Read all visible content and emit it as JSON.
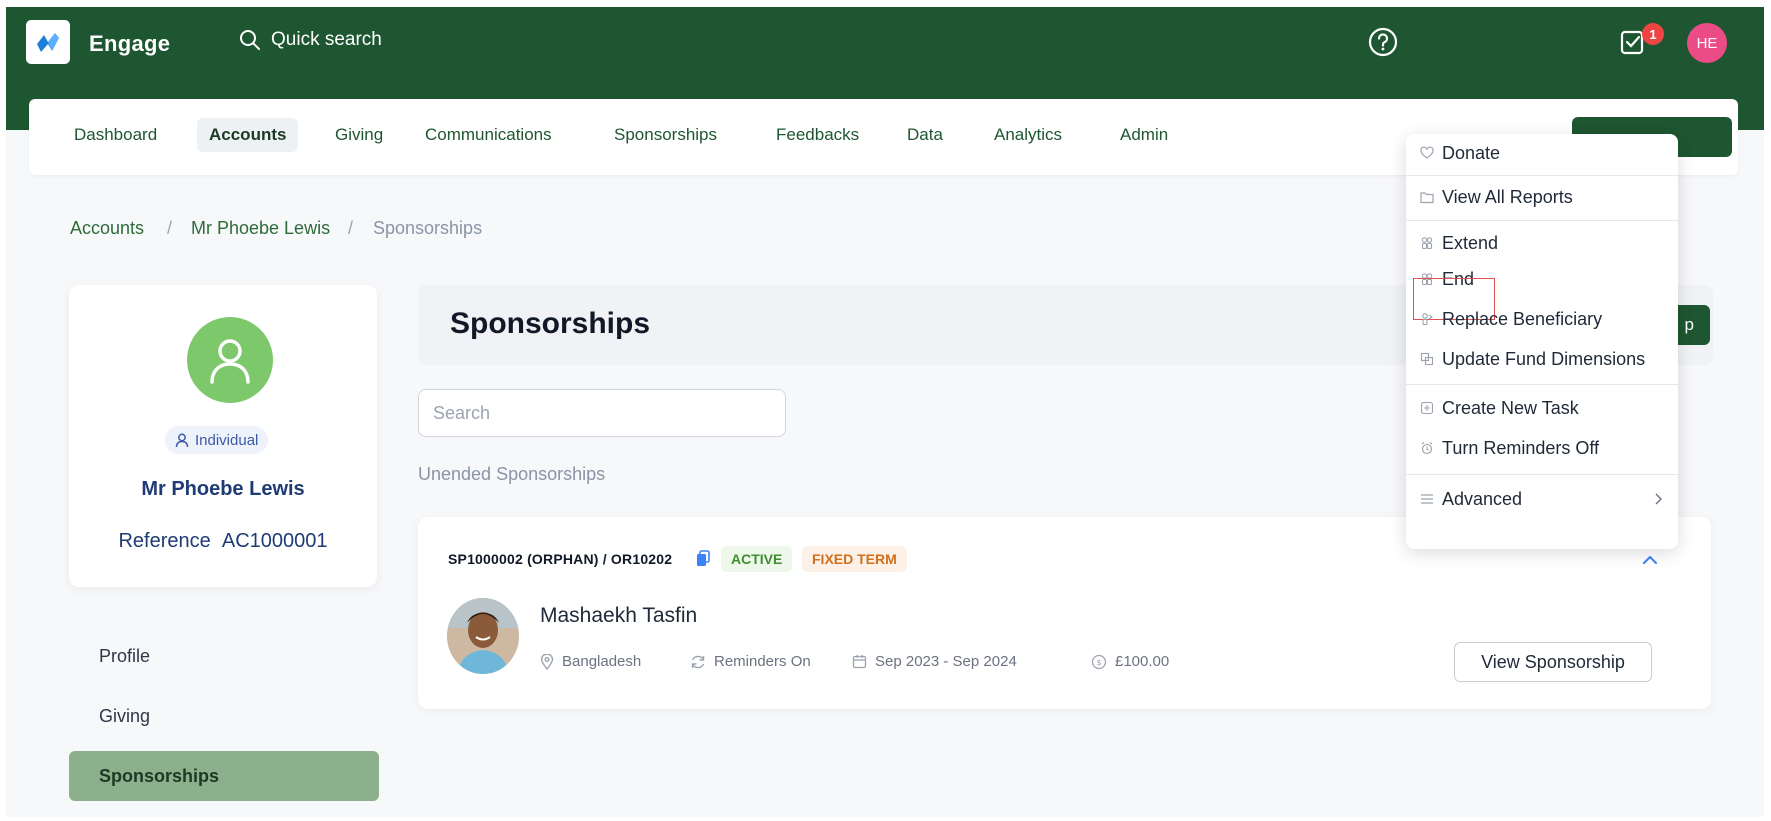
{
  "app": {
    "name": "Engage",
    "quick_search": "Quick search",
    "notification_count": "1",
    "user_initials": "HE"
  },
  "nav": {
    "items": [
      {
        "label": "Dashboard",
        "active": false
      },
      {
        "label": "Accounts",
        "active": true
      },
      {
        "label": "Giving",
        "active": false
      },
      {
        "label": "Communications",
        "active": false
      },
      {
        "label": "Sponsorships",
        "active": false
      },
      {
        "label": "Feedbacks",
        "active": false
      },
      {
        "label": "Data",
        "active": false
      },
      {
        "label": "Analytics",
        "active": false
      },
      {
        "label": "Admin",
        "active": false
      }
    ]
  },
  "breadcrumb": [
    "Accounts",
    "Mr Phoebe Lewis",
    "Sponsorships"
  ],
  "profile": {
    "type": "Individual",
    "name": "Mr Phoebe Lewis",
    "reference_label": "Reference",
    "reference": "AC1000001"
  },
  "sidebar": {
    "items": [
      {
        "label": "Profile",
        "active": false
      },
      {
        "label": "Giving",
        "active": false
      },
      {
        "label": "Sponsorships",
        "active": true
      }
    ]
  },
  "main": {
    "title": "Sponsorships",
    "search_placeholder": "Search",
    "section_label": "Unended Sponsorships",
    "partial_button_text": "p",
    "sponsorship": {
      "code": "SP1000002 (ORPHAN) / OR10202",
      "status": "ACTIVE",
      "term": "FIXED TERM",
      "beneficiary": "Mashaekh Tasfin",
      "country": "Bangladesh",
      "reminders": "Reminders On",
      "period": "Sep 2023 - Sep 2024",
      "amount": "£100.00",
      "view_button": "View Sponsorship"
    }
  },
  "menu": {
    "items": [
      {
        "label": "Donate",
        "icon": "donate-icon"
      },
      {
        "label": "View All Reports",
        "icon": "folder-icon"
      },
      {
        "label": "Extend",
        "icon": "people-icon"
      },
      {
        "label": "End",
        "icon": "people-icon"
      },
      {
        "label": "Replace Beneficiary",
        "icon": "replace-icon"
      },
      {
        "label": "Update Fund Dimensions",
        "icon": "layers-icon"
      },
      {
        "label": "Create New Task",
        "icon": "task-icon"
      },
      {
        "label": "Turn Reminders Off",
        "icon": "alarm-icon"
      },
      {
        "label": "Advanced",
        "icon": "menu-lines-icon"
      }
    ]
  },
  "colors": {
    "brand_green": "#1e5631",
    "active_side": "#8db08c",
    "badge_red": "#ef4444",
    "avatar_pink": "#ec4c86",
    "highlight": "#e05252"
  }
}
